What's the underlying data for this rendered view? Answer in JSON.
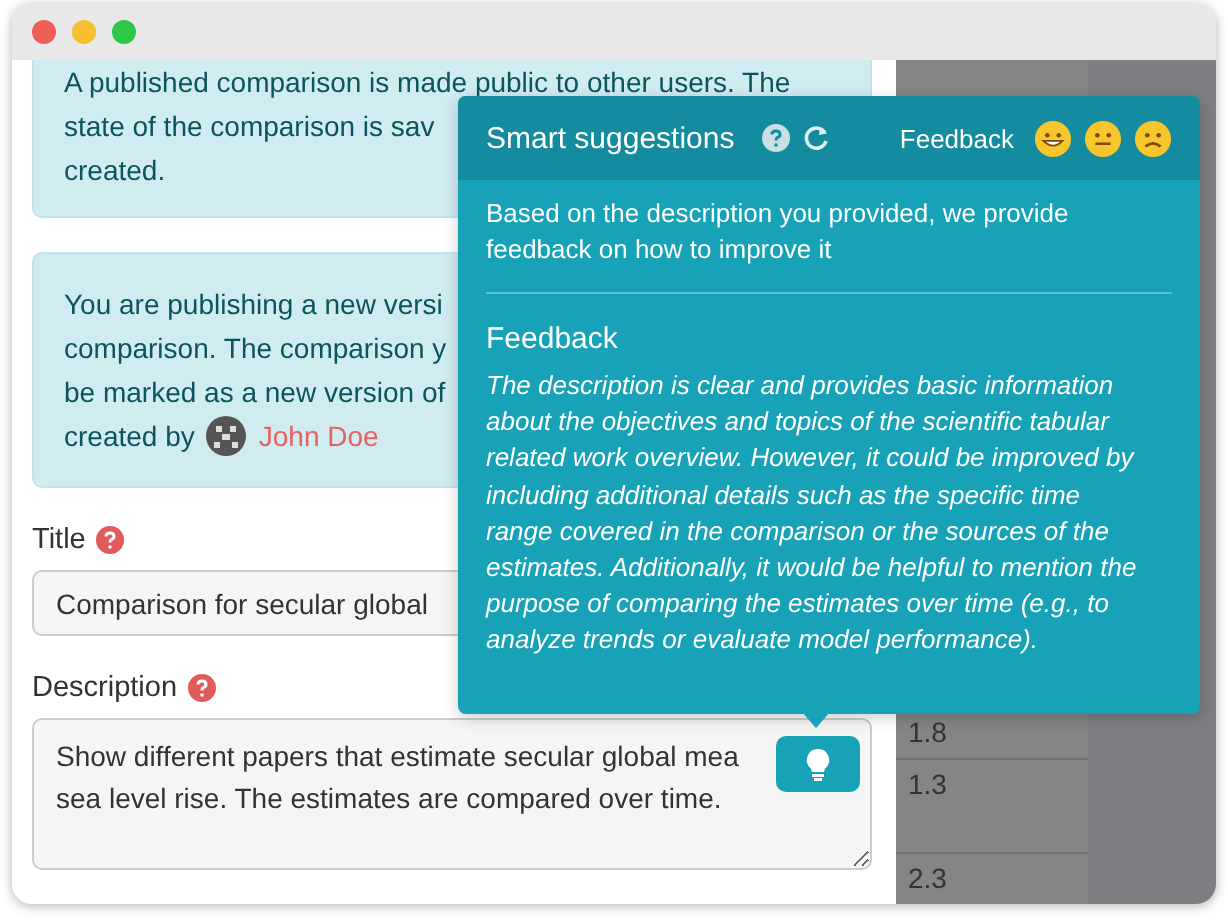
{
  "notices": [
    {
      "lines": [
        "A published comparison is made public to other users. The",
        "state of the comparison is sav",
        "created."
      ]
    },
    {
      "lines": [
        "You are publishing a new versi",
        "comparison. The comparison y",
        "be marked as a new version of"
      ],
      "author": {
        "prefix": "created by",
        "name": "John Doe"
      }
    }
  ],
  "fields": [
    {
      "kind": "input",
      "label": "Title",
      "value": "Comparison for secular global"
    },
    {
      "kind": "textarea",
      "label": "Description",
      "value": "Show different papers that estimate secular global mea\nsea level rise. The estimates are compared over time."
    }
  ],
  "background_table": {
    "cells": [
      "1.8",
      "1.3",
      "2.3"
    ]
  },
  "suggestions": {
    "title": "Smart suggestions",
    "feedback_label": "Feedback",
    "ratings": [
      {
        "kind": "grinning"
      },
      {
        "kind": "neutral"
      },
      {
        "kind": "frowning"
      }
    ],
    "intro": "Based on the description you provided, we provide feedback on how to improve it",
    "heading": "Feedback",
    "text": "The description is clear and provides basic information about the objectives and topics of the scientific tabular related work overview. However, it could be improved by including additional details such as the specific time range covered in the comparison or the sources of the estimates. Additionally, it would be helpful to mention the purpose of comparing the estimates over time (e.g., to analyze trends or evaluate model performance)."
  }
}
